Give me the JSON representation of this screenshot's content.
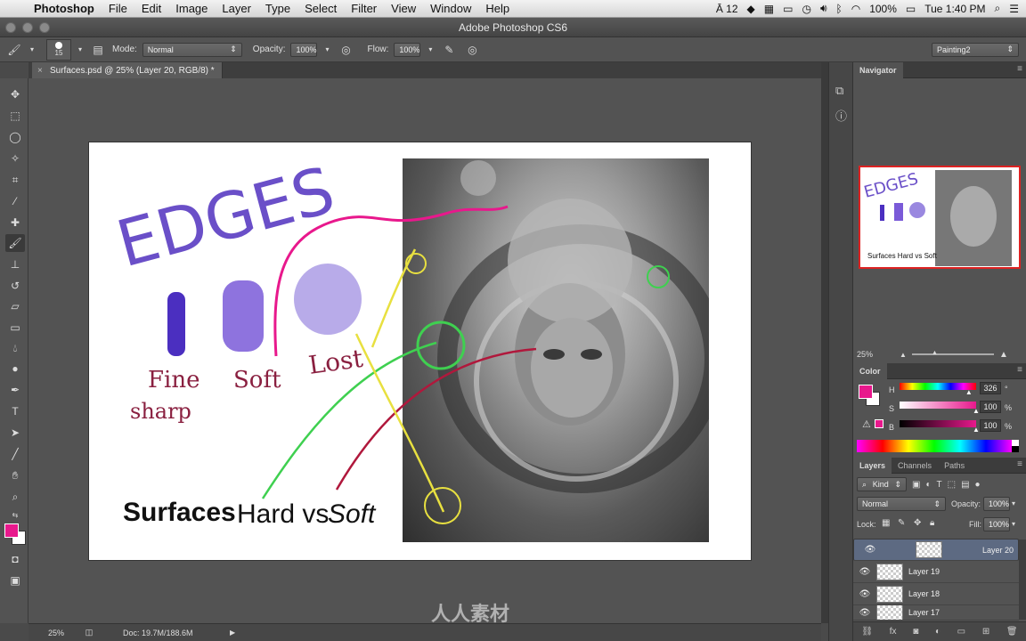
{
  "menubar": {
    "apple": "",
    "app_name": "Photoshop",
    "items": [
      "File",
      "Edit",
      "Image",
      "Layer",
      "Type",
      "Select",
      "Filter",
      "View",
      "Window",
      "Help"
    ],
    "status": {
      "adobe": "12",
      "battery": "100%",
      "clock": "Tue 1:40 PM"
    }
  },
  "window": {
    "title": "Adobe Photoshop CS6"
  },
  "options": {
    "brush_size": "15",
    "mode_label": "Mode:",
    "mode_value": "Normal",
    "opacity_label": "Opacity:",
    "opacity_value": "100%",
    "flow_label": "Flow:",
    "flow_value": "100%",
    "workspace": "Painting2"
  },
  "document": {
    "tab_title": "Surfaces.psd @ 25% (Layer 20, RGB/8) *"
  },
  "artwork": {
    "heading": "EDGES",
    "edge_labels": [
      "Fine",
      "sharp",
      "Soft",
      "Lost"
    ],
    "caption_bold": "Surfaces",
    "caption_regular": "Hard vs",
    "caption_italic": "Soft",
    "thumb_heading": "EDGES",
    "thumb_caption": "Surfaces Hard vs Soft"
  },
  "statusbar": {
    "zoom": "25%",
    "doc_info": "Doc: 19.7M/188.6M"
  },
  "navigator": {
    "title": "Navigator",
    "zoom": "25%"
  },
  "color_panel": {
    "title": "Color",
    "fg_color": "#e8188c",
    "channels": [
      {
        "label": "H",
        "value": "326",
        "unit": "°",
        "level": 0.906
      },
      {
        "label": "S",
        "value": "100",
        "unit": "%",
        "level": 1.0
      },
      {
        "label": "B",
        "value": "100",
        "unit": "%",
        "level": 1.0
      }
    ]
  },
  "layers_panel": {
    "tabs": [
      "Layers",
      "Channels",
      "Paths"
    ],
    "filter": "Kind",
    "blend_mode": "Normal",
    "opacity_label": "Opacity:",
    "opacity_value": "100%",
    "lock_label": "Lock:",
    "fill_label": "Fill:",
    "fill_value": "100%",
    "layers": [
      {
        "name": "Layer 20",
        "selected": true
      },
      {
        "name": "Layer 19",
        "selected": false
      },
      {
        "name": "Layer 18",
        "selected": false
      },
      {
        "name": "Layer 17",
        "selected": false
      }
    ]
  },
  "watermark": {
    "text": "人人素材"
  }
}
